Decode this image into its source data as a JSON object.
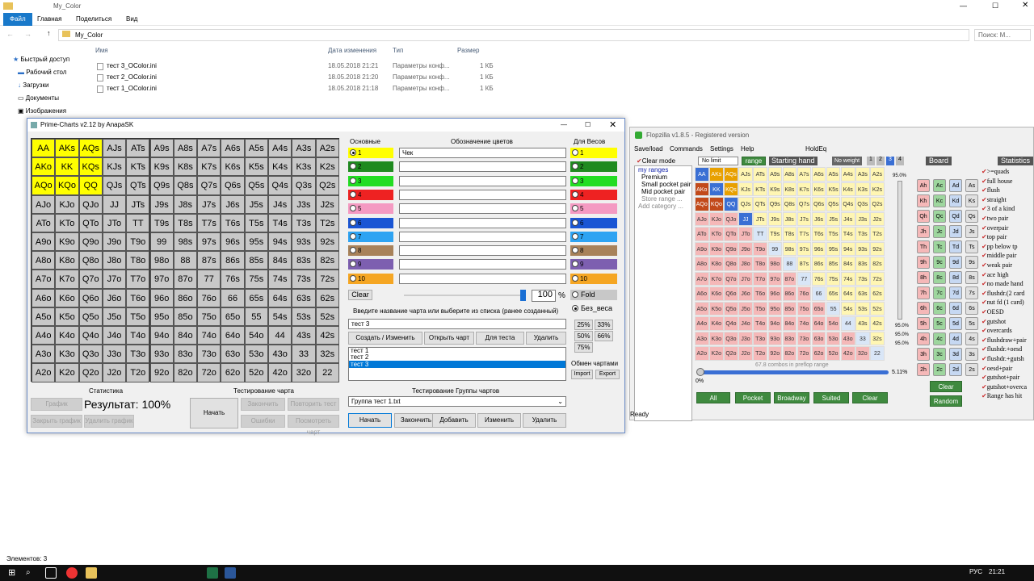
{
  "explorer": {
    "title": "My_Color",
    "tabs": [
      "Файл",
      "Главная",
      "Поделиться",
      "Вид"
    ],
    "path": "My_Color",
    "search_placeholder": "Поиск: M...",
    "nav": [
      {
        "label": "Быстрый доступ"
      },
      {
        "label": "Рабочий стол"
      },
      {
        "label": "Загрузки"
      },
      {
        "label": "Документы"
      },
      {
        "label": "Изображения"
      }
    ],
    "columns": [
      "Имя",
      "Дата изменения",
      "Тип",
      "Размер"
    ],
    "files": [
      {
        "name": "тест 3_OColor.ini",
        "date": "18.05.2018 21:21",
        "type": "Параметры конф...",
        "size": "1 КБ"
      },
      {
        "name": "тест 2_OColor.ini",
        "date": "18.05.2018 21:20",
        "type": "Параметры конф...",
        "size": "1 КБ"
      },
      {
        "name": "тест 1_OColor.ini",
        "date": "18.05.2018 21:18",
        "type": "Параметры конф...",
        "size": "1 КБ"
      }
    ],
    "status": "Элементов: 3"
  },
  "prime": {
    "title": "Prime-Charts v2.12 by AnapaSK",
    "grid": [
      [
        "AA",
        "AKs",
        "AQs",
        "AJs",
        "ATs",
        "A9s",
        "A8s",
        "A7s",
        "A6s",
        "A5s",
        "A4s",
        "A3s",
        "A2s"
      ],
      [
        "AKo",
        "KK",
        "KQs",
        "KJs",
        "KTs",
        "K9s",
        "K8s",
        "K7s",
        "K6s",
        "K5s",
        "K4s",
        "K3s",
        "K2s"
      ],
      [
        "AQo",
        "KQo",
        "QQ",
        "QJs",
        "QTs",
        "Q9s",
        "Q8s",
        "Q7s",
        "Q6s",
        "Q5s",
        "Q4s",
        "Q3s",
        "Q2s"
      ],
      [
        "AJo",
        "KJo",
        "QJo",
        "JJ",
        "JTs",
        "J9s",
        "J8s",
        "J7s",
        "J6s",
        "J5s",
        "J4s",
        "J3s",
        "J2s"
      ],
      [
        "ATo",
        "KTo",
        "QTo",
        "JTo",
        "TT",
        "T9s",
        "T8s",
        "T7s",
        "T6s",
        "T5s",
        "T4s",
        "T3s",
        "T2s"
      ],
      [
        "A9o",
        "K9o",
        "Q9o",
        "J9o",
        "T9o",
        "99",
        "98s",
        "97s",
        "96s",
        "95s",
        "94s",
        "93s",
        "92s"
      ],
      [
        "A8o",
        "K8o",
        "Q8o",
        "J8o",
        "T8o",
        "98o",
        "88",
        "87s",
        "86s",
        "85s",
        "84s",
        "83s",
        "82s"
      ],
      [
        "A7o",
        "K7o",
        "Q7o",
        "J7o",
        "T7o",
        "97o",
        "87o",
        "77",
        "76s",
        "75s",
        "74s",
        "73s",
        "72s"
      ],
      [
        "A6o",
        "K6o",
        "Q6o",
        "J6o",
        "T6o",
        "96o",
        "86o",
        "76o",
        "66",
        "65s",
        "64s",
        "63s",
        "62s"
      ],
      [
        "A5o",
        "K5o",
        "Q5o",
        "J5o",
        "T5o",
        "95o",
        "85o",
        "75o",
        "65o",
        "55",
        "54s",
        "53s",
        "52s"
      ],
      [
        "A4o",
        "K4o",
        "Q4o",
        "J4o",
        "T4o",
        "94o",
        "84o",
        "74o",
        "64o",
        "54o",
        "44",
        "43s",
        "42s"
      ],
      [
        "A3o",
        "K3o",
        "Q3o",
        "J3o",
        "T3o",
        "93o",
        "83o",
        "73o",
        "63o",
        "53o",
        "43o",
        "33",
        "32s"
      ],
      [
        "A2o",
        "K2o",
        "Q2o",
        "J2o",
        "T2o",
        "92o",
        "82o",
        "72o",
        "62o",
        "52o",
        "42o",
        "32o",
        "22"
      ]
    ],
    "yellow": [
      "AA",
      "AKs",
      "AQs",
      "AKo",
      "KK",
      "KQs",
      "AQo",
      "KQo",
      "QQ"
    ],
    "main_label": "Основные",
    "colors_label": "Обозначение цветов",
    "weights_label": "Для Весов",
    "colors": [
      {
        "n": "1",
        "c": "#ffff00",
        "desc": "Чек",
        "wc": "#ffff00"
      },
      {
        "n": "2",
        "c": "#1f8a1f",
        "desc": "",
        "wc": "#1f8a1f"
      },
      {
        "n": "3",
        "c": "#22dd22",
        "desc": "",
        "wc": "#22dd22"
      },
      {
        "n": "4",
        "c": "#ee2222",
        "desc": "",
        "wc": "#ee2222"
      },
      {
        "n": "5",
        "c": "#f49ac2",
        "desc": "",
        "wc": "#f49ac2"
      },
      {
        "n": "6",
        "c": "#1a55d4",
        "desc": "",
        "wc": "#1a55d4"
      },
      {
        "n": "7",
        "c": "#2ea3f2",
        "desc": "",
        "wc": "#2ea3f2"
      },
      {
        "n": "8",
        "c": "#a8825a",
        "desc": "",
        "wc": "#a8825a"
      },
      {
        "n": "9",
        "c": "#7d5fb0",
        "desc": "",
        "wc": "#7d5fb0"
      },
      {
        "n": "10",
        "c": "#f5a623",
        "desc": "",
        "wc": "#f5a623"
      }
    ],
    "clear": "Clear",
    "percent": "100",
    "percent_sign": "%",
    "fold": "Fold",
    "noweight": "Без_веса",
    "prompt": "Введите название чарта или выберите из списка (ранее созданный)",
    "chart_name": "тест 3",
    "buttons": [
      "Создать / Изменить чарт",
      "Открыть чарт",
      "Для теста",
      "Удалить чарт"
    ],
    "chart_list": [
      "тест 1",
      "тест 2",
      "тест 3"
    ],
    "weight_pcts": [
      "25%",
      "33%",
      "50%",
      "66%",
      "75%"
    ],
    "exchange_label": "Обмен чартами",
    "import": "Import",
    "export": "Export",
    "stats_label": "Статистика",
    "stat_btns": [
      "График",
      "Закрыть график",
      "Удалить график"
    ],
    "result": "Результат: 100%",
    "test_label": "Тестирование чарта",
    "start": "Начать",
    "test_btns": [
      "Закончить",
      "Повторить тест",
      "Ошибки",
      "Посмотреть чарт"
    ],
    "group_label": "Тестирование Группы чартов",
    "group_value": "Группа тест 1.txt",
    "group_btns": [
      "Начать",
      "Закончить",
      "Добавить",
      "Изменить",
      "Удалить"
    ]
  },
  "flop": {
    "title": "Flopzilla v1.8.5 - Registered version",
    "menu": [
      "Save/load",
      "Commands",
      "Settings",
      "Help",
      "HoldEq"
    ],
    "clear_mode": "Clear mode",
    "no_limit": "No limit",
    "range_btn": "range",
    "starting_hand": "Starting hand",
    "no_weight": "No weight",
    "weights": [
      "1",
      "2",
      "3",
      "4"
    ],
    "board_label": "Board",
    "stats_label": "Statistics",
    "ranges": [
      "my ranges",
      "Premium",
      "Small pocket pair",
      "Mid pocket pair",
      "Store range ...",
      "Add category ..."
    ],
    "combos": "67.8 combos in preflop range",
    "pct_left": "0%",
    "pct_right": "5.11%",
    "pct_top": "95.0%",
    "pct_s1": "95.0%",
    "pct_s2": "95.0%",
    "pct_s3": "95.0%",
    "bottom_btns": [
      "All",
      "Pocket",
      "Broadway",
      "Suited",
      "Clear"
    ],
    "board_btns": [
      "Clear",
      "Random"
    ],
    "board": [
      [
        "Ah",
        "Ac",
        "Ad",
        "As"
      ],
      [
        "Kh",
        "Kc",
        "Kd",
        "Ks"
      ],
      [
        "Qh",
        "Qc",
        "Qd",
        "Qs"
      ],
      [
        "Jh",
        "Jc",
        "Jd",
        "Js"
      ],
      [
        "Th",
        "Tc",
        "Td",
        "Ts"
      ],
      [
        "9h",
        "9c",
        "9d",
        "9s"
      ],
      [
        "8h",
        "8c",
        "8d",
        "8s"
      ],
      [
        "7h",
        "7c",
        "7d",
        "7s"
      ],
      [
        "6h",
        "6c",
        "6d",
        "6s"
      ],
      [
        "5h",
        "5c",
        "5d",
        "5s"
      ],
      [
        "4h",
        "4c",
        "4d",
        "4s"
      ],
      [
        "3h",
        "3c",
        "3d",
        "3s"
      ],
      [
        "2h",
        "2c",
        "2d",
        "2s"
      ]
    ],
    "stats": [
      ">=quads",
      "full house",
      "flush",
      "straight",
      "3 of a kind",
      "two pair",
      "overpair",
      "top pair",
      "pp below tp",
      "middle pair",
      "weak pair",
      "ace high",
      "no made hand",
      "flushdr.(2 card",
      "nut fd (1 card)",
      "OESD",
      "gutshot",
      "overcards",
      "flushdraw+pair",
      "flushdr.+oesd",
      "flushdr.+gutsh",
      "oesd+pair",
      "gutshot+pair",
      "gutshot+overca",
      "Range has hit"
    ],
    "status": "Ready"
  },
  "taskbar": {
    "lang": "РУС",
    "time": "21:21"
  },
  "colors": {
    "accent": "#0078d7",
    "yellow": "#ffff00",
    "grid_gray": "#c8c8c8",
    "selection": "#0078d7"
  }
}
